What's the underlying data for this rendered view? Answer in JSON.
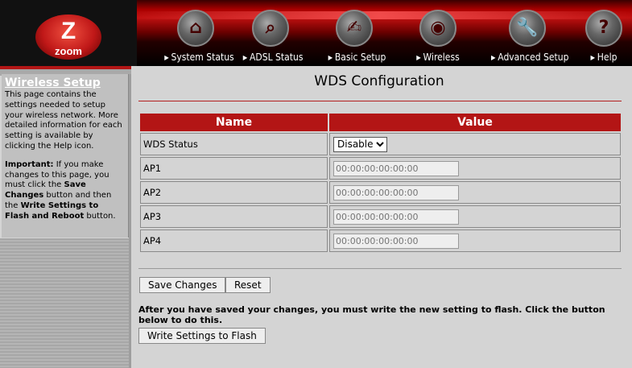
{
  "brand": {
    "logo_letter": "Z",
    "logo_word": "zoom"
  },
  "nav": [
    {
      "label": "System Status",
      "icon": "home-icon",
      "glyph": "⌂"
    },
    {
      "label": "ADSL Status",
      "icon": "magnifier-icon",
      "glyph": "⌕"
    },
    {
      "label": "Basic Setup",
      "icon": "hand-icon",
      "glyph": "✍"
    },
    {
      "label": "Wireless",
      "icon": "antenna-icon",
      "glyph": "◉"
    },
    {
      "label": "Advanced Setup",
      "icon": "wrench-icon",
      "glyph": "🔧"
    },
    {
      "label": "Help",
      "icon": "question-icon",
      "glyph": "?"
    }
  ],
  "sidebar": {
    "title": "Wireless Setup",
    "intro": "This page contains the settings needed to setup your wireless network. More detailed information for each setting is available by clicking the Help icon.",
    "important_label": "Important:",
    "important_text_1": " If you make changes to this page, you must click the ",
    "save_changes_bold": "Save Changes",
    "important_text_2": " button and then the ",
    "write_settings_bold": "Write Settings to Flash and Reboot",
    "important_text_3": " button."
  },
  "page": {
    "title": "WDS Configuration",
    "table": {
      "headers": {
        "name": "Name",
        "value": "Value"
      },
      "wds_status": {
        "label": "WDS Status",
        "selected": "Disable"
      },
      "aps": [
        {
          "label": "AP1",
          "placeholder": "00:00:00:00:00:00"
        },
        {
          "label": "AP2",
          "placeholder": "00:00:00:00:00:00"
        },
        {
          "label": "AP3",
          "placeholder": "00:00:00:00:00:00"
        },
        {
          "label": "AP4",
          "placeholder": "00:00:00:00:00:00"
        }
      ]
    },
    "buttons": {
      "save": "Save Changes",
      "reset": "Reset",
      "write": "Write Settings to Flash"
    },
    "note": "After you have saved your changes, you must write the new setting to flash. Click the button below to do this."
  },
  "colors": {
    "accent": "#b31515",
    "background": "#d4d4d4"
  }
}
